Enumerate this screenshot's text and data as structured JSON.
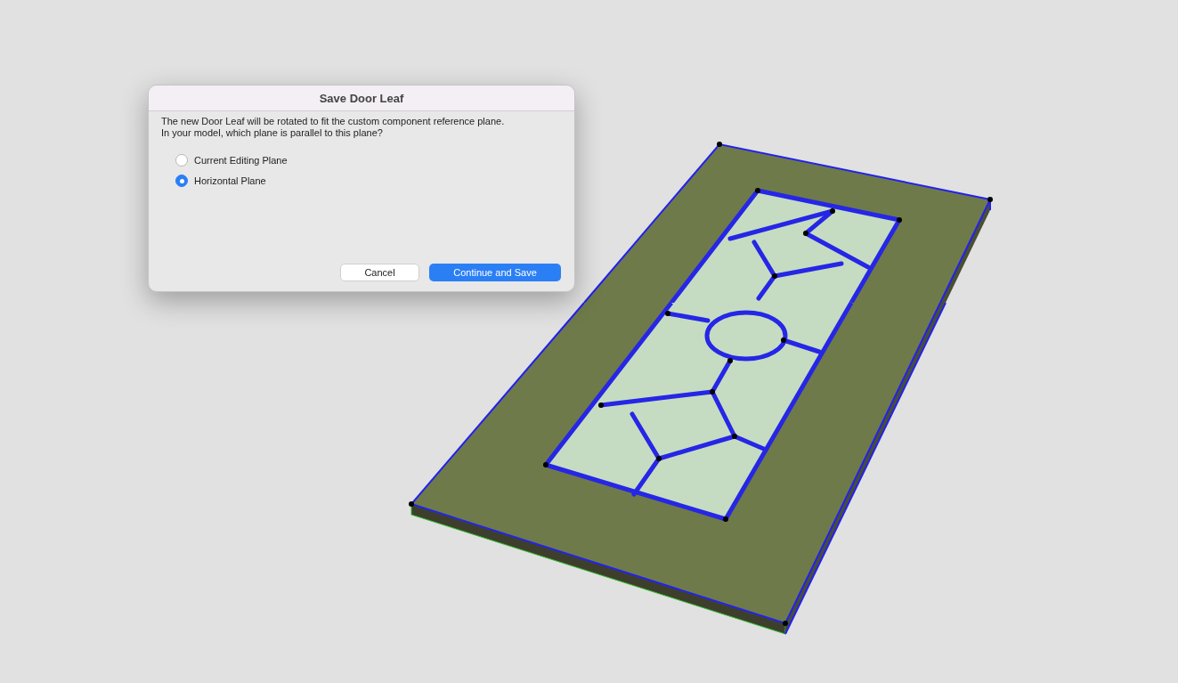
{
  "dialog": {
    "title": "Save Door Leaf",
    "message_lines": [
      "The new Door Leaf will be rotated to fit the custom component reference plane.",
      "In your model, which plane is parallel to this plane?"
    ],
    "options": [
      {
        "label": "Current Editing Plane",
        "selected": false
      },
      {
        "label": "Horizontal Plane",
        "selected": true
      }
    ],
    "buttons": [
      {
        "label": "Cancel",
        "kind": "secondary"
      },
      {
        "label": "Continue and Save",
        "kind": "primary"
      }
    ]
  }
}
